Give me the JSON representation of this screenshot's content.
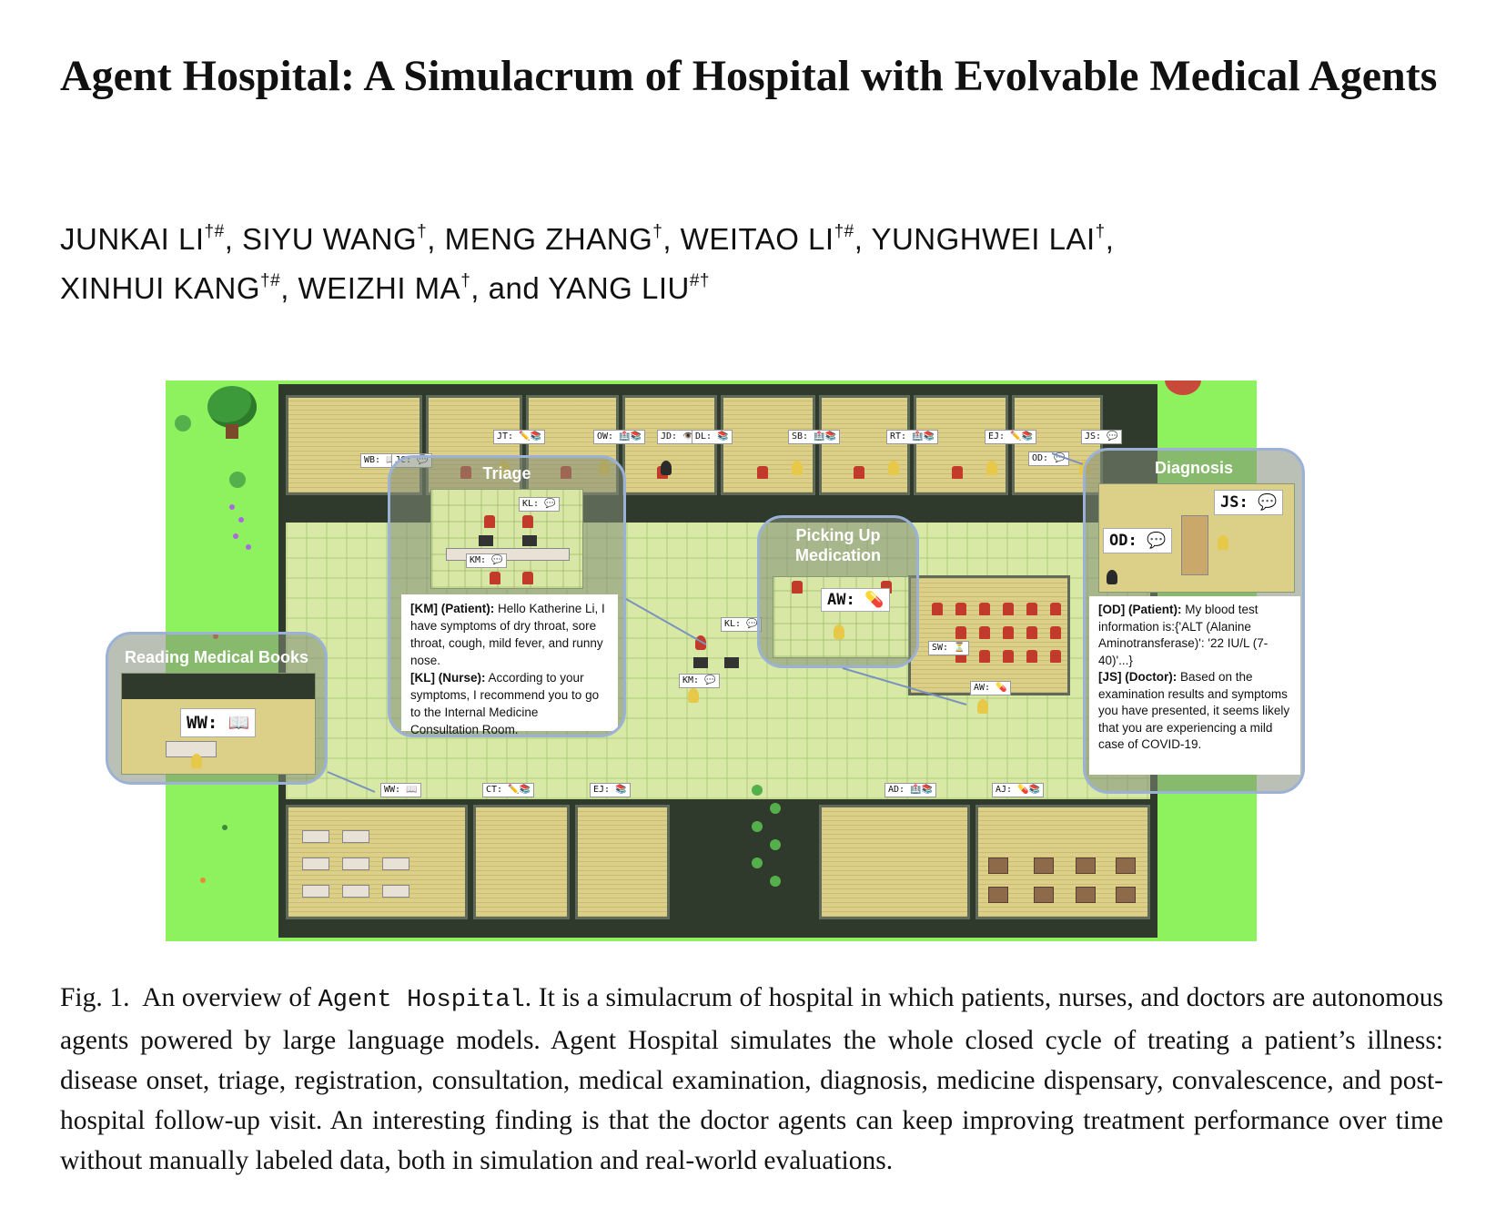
{
  "paper": {
    "title": "Agent Hospital: A Simulacrum of Hospital with Evolvable Medical Agents",
    "authors": [
      {
        "name": "JUNKAI LI",
        "marks": "†#"
      },
      {
        "name": "SIYU WANG",
        "marks": "†"
      },
      {
        "name": "MENG ZHANG",
        "marks": "†"
      },
      {
        "name": "WEITAO LI",
        "marks": "†#"
      },
      {
        "name": "YUNGHWEI LAI",
        "marks": "†"
      },
      {
        "name": "XINHUI KANG",
        "marks": "†#"
      },
      {
        "name": "WEIZHI MA",
        "marks": "†"
      },
      {
        "name": "YANG LIU",
        "marks": "#†"
      }
    ],
    "author_conjunction": "and"
  },
  "figure": {
    "room_tags": [
      "WB: 📖",
      "JC: 💬",
      "JT: ✏️📚",
      "OW: 🏥📚",
      "JD: 👁️",
      "DL: 📚",
      "SB: 🏥📚",
      "RT: 🏥📚",
      "EJ: ✏️📚",
      "JS: 💬",
      "OD: 💬",
      "KL: 💬",
      "KM: 💬",
      "SW: ⏳",
      "AW: 💊",
      "WW: 📖",
      "CT: ✏️📚",
      "EJ: 📚",
      "AD: 🏥📚",
      "AJ: 💊📚"
    ],
    "panels": {
      "triage": {
        "title": "Triage",
        "tag_kl": "KL: 💬",
        "tag_km": "KM: 💬",
        "dialog": [
          {
            "speaker": "[KM] (Patient):",
            "text": " Hello Katherine Li, I have symptoms of dry throat, sore throat, cough, mild fever, and runny nose."
          },
          {
            "speaker": "[KL] (Nurse):",
            "text": " According to your symptoms, I recommend you to go to the Internal Medicine Consultation Room."
          }
        ]
      },
      "medication": {
        "title_line1": "Picking Up",
        "title_line2": "Medication",
        "tag": "AW: 💊"
      },
      "reading": {
        "title": "Reading Medical Books",
        "tag": "WW: 📖"
      },
      "diagnosis": {
        "title": "Diagnosis",
        "tag_js": "JS: 💬",
        "tag_od": "OD: 💬",
        "dialog": [
          {
            "speaker": "[OD] (Patient):",
            "text": " My blood test information is:{'ALT (Alanine Aminotransferase)': '22 IU/L (7-40)'...}"
          },
          {
            "speaker": "[JS] (Doctor):",
            "text": " Based on the examination results and symptoms you have presented, it seems likely that you are experiencing a mild case of COVID-19."
          }
        ]
      }
    },
    "caption": {
      "label": "Fig. 1.",
      "pre": "An overview of",
      "system": "Agent Hospital",
      "body": ". It is a simulacrum of hospital in which patients, nurses, and doctors are autonomous agents powered by large language models. Agent Hospital simulates the whole closed cycle of treating a patient’s illness: disease onset, triage, registration, consultation, medical examination, diagnosis, medicine dispensary, convalescence, and post-hospital follow-up visit. An interesting finding is that the doctor agents can keep improving treatment performance over time without manually labeled data, both in simulation and real-world evaluations."
    }
  }
}
